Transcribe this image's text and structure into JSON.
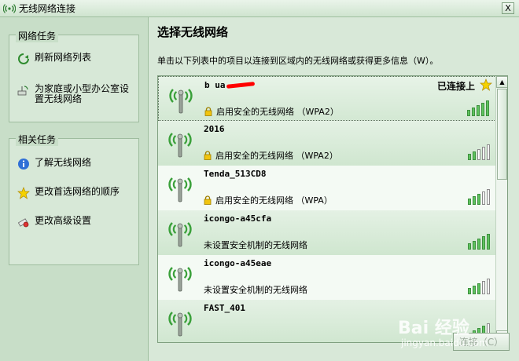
{
  "window": {
    "title": "无线网络连接",
    "close_label": "X"
  },
  "network_tasks": {
    "title": "网络任务",
    "items": [
      {
        "label": "刷新网络列表",
        "icon": "refresh-icon"
      },
      {
        "label": "为家庭或小型办公室设置无线网络",
        "icon": "wireless-setup-icon"
      }
    ]
  },
  "related_tasks": {
    "title": "相关任务",
    "items": [
      {
        "label": "了解无线网络",
        "icon": "info-icon"
      },
      {
        "label": "更改首选网络的顺序",
        "icon": "star-icon"
      },
      {
        "label": "更改高级设置",
        "icon": "settings-icon"
      }
    ]
  },
  "main": {
    "heading": "选择无线网络",
    "instruction": "单击以下列表中的项目以连接到区域内的无线网络或获得更多信息（W）。"
  },
  "networks": [
    {
      "ssid": "b    ua",
      "security": "启用安全的无线网络 （WPA2）",
      "secured": true,
      "status": "已连接上",
      "signal": 5,
      "signal_of": 5,
      "preferred": true
    },
    {
      "ssid": "2016",
      "security": "启用安全的无线网络 （WPA2）",
      "secured": true,
      "status": "",
      "signal": 2,
      "signal_of": 5,
      "preferred": false
    },
    {
      "ssid": "Tenda_513CD8",
      "security": "启用安全的无线网络 （WPA）",
      "secured": true,
      "status": "",
      "signal": 3,
      "signal_of": 5,
      "preferred": false
    },
    {
      "ssid": "icongo-a45cfa",
      "security": "未设置安全机制的无线网络",
      "secured": false,
      "status": "",
      "signal": 5,
      "signal_of": 5,
      "preferred": false
    },
    {
      "ssid": "icongo-a45eae",
      "security": "未设置安全机制的无线网络",
      "secured": false,
      "status": "",
      "signal": 3,
      "signal_of": 5,
      "preferred": false
    },
    {
      "ssid": "FAST_401",
      "security": "",
      "secured": false,
      "status": "",
      "signal": 4,
      "signal_of": 5,
      "preferred": false
    }
  ],
  "connect_button": {
    "label": "连接（C）"
  },
  "watermark": {
    "logo": "Bai 经验",
    "url": "jingyan.baidu.com"
  },
  "colors": {
    "signal_on": "#5ec35e",
    "signal_off": "#ffffff",
    "redaction": "#ff0000"
  }
}
